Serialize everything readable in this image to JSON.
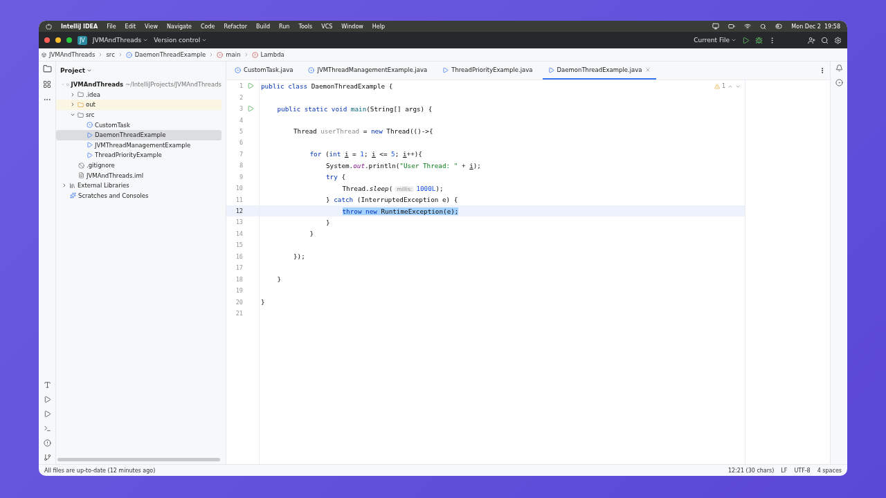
{
  "menu_bar": {
    "app": "IntelliJ IDEA",
    "items": [
      "File",
      "Edit",
      "View",
      "Navigate",
      "Code",
      "Refactor",
      "Build",
      "Run",
      "Tools",
      "VCS",
      "Window",
      "Help"
    ],
    "clock": "Mon Dec 2  19:58"
  },
  "title_bar": {
    "project_badge": "JV",
    "project": "JVMAndThreads",
    "vcs": "Version control",
    "run_config": "Current File"
  },
  "breadcrumbs": [
    {
      "label": "JVMAndThreads",
      "kind": "module"
    },
    {
      "label": "src",
      "kind": "folder"
    },
    {
      "label": "DaemonThreadExample",
      "kind": "class"
    },
    {
      "label": "main",
      "kind": "method"
    },
    {
      "label": "Lambda",
      "kind": "lambda"
    }
  ],
  "project_panel": {
    "title": "Project",
    "tree": [
      {
        "label": "JVMAndThreads",
        "path": "~/IntelliJProjects/JVMAndThreads",
        "kind": "module",
        "expanded": true,
        "selected": false,
        "children": [
          {
            "label": ".idea",
            "kind": "folder",
            "expanded": false,
            "selected": false
          },
          {
            "label": "out",
            "kind": "excluded",
            "expanded": false,
            "selected": false
          },
          {
            "label": "src",
            "kind": "folder",
            "expanded": true,
            "selected": false,
            "children": [
              {
                "label": "CustomTask",
                "kind": "class",
                "selected": false
              },
              {
                "label": "DaemonThreadExample",
                "kind": "runnable",
                "selected": true
              },
              {
                "label": "JVMThreadManagementExample",
                "kind": "runnable",
                "selected": false
              },
              {
                "label": "ThreadPriorityExample",
                "kind": "runnable",
                "selected": false
              }
            ]
          },
          {
            "label": ".gitignore",
            "kind": "ignore",
            "selected": false
          },
          {
            "label": "JVMAndThreads.iml",
            "kind": "file",
            "selected": false
          }
        ]
      },
      {
        "label": "External Libraries",
        "kind": "library",
        "expanded": false,
        "selected": false
      },
      {
        "label": "Scratches and Consoles",
        "kind": "scratch",
        "selected": false
      }
    ]
  },
  "tabs": [
    {
      "label": "CustomTask.java",
      "kind": "class",
      "selected": false
    },
    {
      "label": "JVMThreadManagementExample.java",
      "kind": "class",
      "selected": false
    },
    {
      "label": "ThreadPriorityExample.java",
      "kind": "runnable",
      "selected": false
    },
    {
      "label": "DaemonThreadExample.java",
      "kind": "runnable",
      "selected": true
    }
  ],
  "inspection": {
    "warnings": "1"
  },
  "code": [
    {
      "n": "1",
      "run": true,
      "current": false,
      "tokens": [
        {
          "t": "public class ",
          "kind": "keyword"
        },
        {
          "t": "DaemonThreadExample {",
          "kind": "plain"
        }
      ],
      "children": [
        {
          "n": "2",
          "run": false,
          "current": false
        },
        {
          "n": "3",
          "run": true,
          "current": false,
          "tokens": [
            {
              "t": "public static void ",
              "kind": "keyword"
            },
            {
              "t": "main",
              "kind": "declaration"
            },
            {
              "t": "(String[] args) {",
              "kind": "plain"
            }
          ],
          "children": [
            {
              "n": "4",
              "run": false,
              "current": false
            },
            {
              "n": "5",
              "run": false,
              "current": false,
              "tokens": [
                {
                  "t": "Thread ",
                  "kind": "plain"
                },
                {
                  "t": "userThread",
                  "kind": "unused"
                },
                {
                  "t": " = ",
                  "kind": "plain"
                },
                {
                  "t": "new ",
                  "kind": "keyword"
                },
                {
                  "t": "Thread(()->{",
                  "kind": "plain"
                }
              ],
              "children": [
                {
                  "n": "6",
                  "run": false,
                  "current": false
                },
                {
                  "n": "7",
                  "run": false,
                  "current": false,
                  "tokens": [
                    {
                      "t": "for ",
                      "kind": "keyword"
                    },
                    {
                      "t": "(",
                      "kind": "plain"
                    },
                    {
                      "t": "int ",
                      "kind": "keyword"
                    },
                    {
                      "t": "i",
                      "kind": "variable"
                    },
                    {
                      "t": " = ",
                      "kind": "plain"
                    },
                    {
                      "t": "1",
                      "kind": "number"
                    },
                    {
                      "t": "; ",
                      "kind": "plain"
                    },
                    {
                      "t": "i",
                      "kind": "variable"
                    },
                    {
                      "t": " <= ",
                      "kind": "plain"
                    },
                    {
                      "t": "5",
                      "kind": "number"
                    },
                    {
                      "t": "; ",
                      "kind": "plain"
                    },
                    {
                      "t": "i",
                      "kind": "variable"
                    },
                    {
                      "t": "++){",
                      "kind": "plain"
                    }
                  ],
                  "children": [
                    {
                      "n": "8",
                      "run": false,
                      "current": false,
                      "tokens": [
                        {
                          "t": "System.",
                          "kind": "plain"
                        },
                        {
                          "t": "out",
                          "kind": "static"
                        },
                        {
                          "t": ".println(",
                          "kind": "plain"
                        },
                        {
                          "t": "\"User Thread: \"",
                          "kind": "string"
                        },
                        {
                          "t": " + ",
                          "kind": "plain"
                        },
                        {
                          "t": "i",
                          "kind": "variable"
                        },
                        {
                          "t": ");",
                          "kind": "plain"
                        }
                      ]
                    },
                    {
                      "n": "9",
                      "run": false,
                      "current": false,
                      "tokens": [
                        {
                          "t": "try ",
                          "kind": "keyword"
                        },
                        {
                          "t": "{",
                          "kind": "plain"
                        }
                      ],
                      "children": [
                        {
                          "n": "10",
                          "run": false,
                          "current": false,
                          "tokens": [
                            {
                              "t": "Thread.",
                              "kind": "plain"
                            },
                            {
                              "t": "sleep",
                              "kind": "italic"
                            },
                            {
                              "t": "(",
                              "kind": "plain"
                            },
                            {
                              "t": "millis:",
                              "kind": "hint"
                            },
                            {
                              "t": "1000L",
                              "kind": "number"
                            },
                            {
                              "t": ");",
                              "kind": "plain"
                            }
                          ]
                        }
                      ]
                    },
                    {
                      "n": "11",
                      "run": false,
                      "current": false,
                      "tokens": [
                        {
                          "t": "} ",
                          "kind": "plain"
                        },
                        {
                          "t": "catch ",
                          "kind": "keyword"
                        },
                        {
                          "t": "(InterruptedException e) {",
                          "kind": "plain"
                        }
                      ],
                      "children": [
                        {
                          "n": "12",
                          "run": false,
                          "current": true,
                          "tokens": [
                            {
                              "t": "throw new ",
                              "kind": "keyword",
                              "selected": true
                            },
                            {
                              "t": "RuntimeException(e);",
                              "kind": "plain",
                              "selected": true
                            }
                          ]
                        }
                      ]
                    },
                    {
                      "n": "13",
                      "run": false,
                      "current": false,
                      "tokens": [
                        {
                          "t": "}",
                          "kind": "plain"
                        }
                      ]
                    }
                  ]
                },
                {
                  "n": "14",
                  "run": false,
                  "current": false,
                  "tokens": [
                    {
                      "t": "}",
                      "kind": "plain"
                    }
                  ]
                },
                {
                  "n": "15",
                  "run": false,
                  "current": false
                }
              ]
            },
            {
              "n": "16",
              "run": false,
              "current": false,
              "tokens": [
                {
                  "t": "});",
                  "kind": "plain"
                }
              ]
            },
            {
              "n": "17",
              "run": false,
              "current": false
            }
          ]
        },
        {
          "n": "18",
          "run": false,
          "current": false,
          "tokens": [
            {
              "t": "}",
              "kind": "plain"
            }
          ]
        },
        {
          "n": "19",
          "run": false,
          "current": false
        }
      ]
    },
    {
      "n": "20",
      "run": false,
      "current": false,
      "tokens": [
        {
          "t": "}",
          "kind": "plain"
        }
      ]
    },
    {
      "n": "21",
      "run": false,
      "current": false
    }
  ],
  "status_bar": {
    "message": "All files are up-to-date (12 minutes ago)",
    "items": [
      "12:21 (30 chars)",
      "LF",
      "UTF-8",
      "4 spaces"
    ]
  }
}
